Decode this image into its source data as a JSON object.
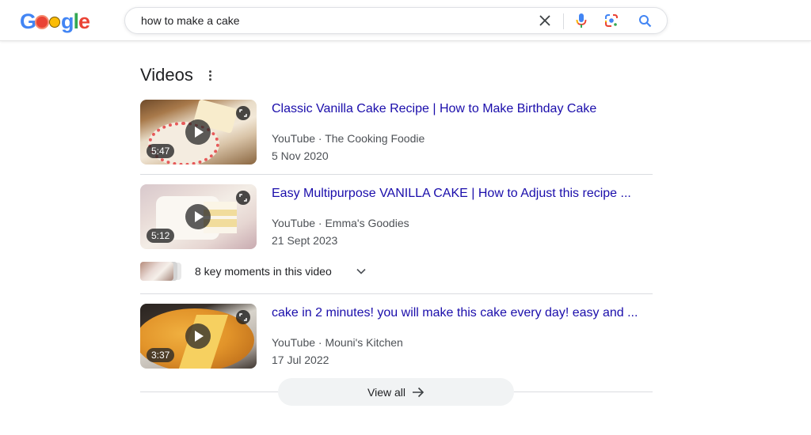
{
  "header": {
    "logo_text": [
      "G",
      "o",
      "o",
      "g",
      "l",
      "e"
    ],
    "search": {
      "value": "how to make a cake",
      "placeholder": ""
    },
    "icons": {
      "clear": "close-icon",
      "mic": "microphone-icon",
      "lens": "google-lens-icon",
      "search": "search-icon"
    }
  },
  "videos": {
    "title": "Videos",
    "more_icon": "more-vert-icon",
    "items": [
      {
        "title": "Classic Vanilla Cake Recipe | How to Make Birthday Cake",
        "source": "YouTube · The Cooking Foodie",
        "date": "5 Nov 2020",
        "duration": "5:47"
      },
      {
        "title": "Easy Multipurpose VANILLA CAKE | How to Adjust this recipe ...",
        "source": "YouTube · Emma's Goodies",
        "date": "21 Sept 2023",
        "duration": "5:12",
        "key_moments": "8 key moments in this video"
      },
      {
        "title": "cake in 2 minutes! you will make this cake every day! easy and ...",
        "source": "YouTube · Mouni's Kitchen",
        "date": "17 Jul 2022",
        "duration": "3:37"
      }
    ],
    "view_all": "View all"
  },
  "colors": {
    "link": "#1a0dab",
    "meta": "#4d5156",
    "divider": "#dadce0",
    "button_bg": "#f1f3f4"
  }
}
